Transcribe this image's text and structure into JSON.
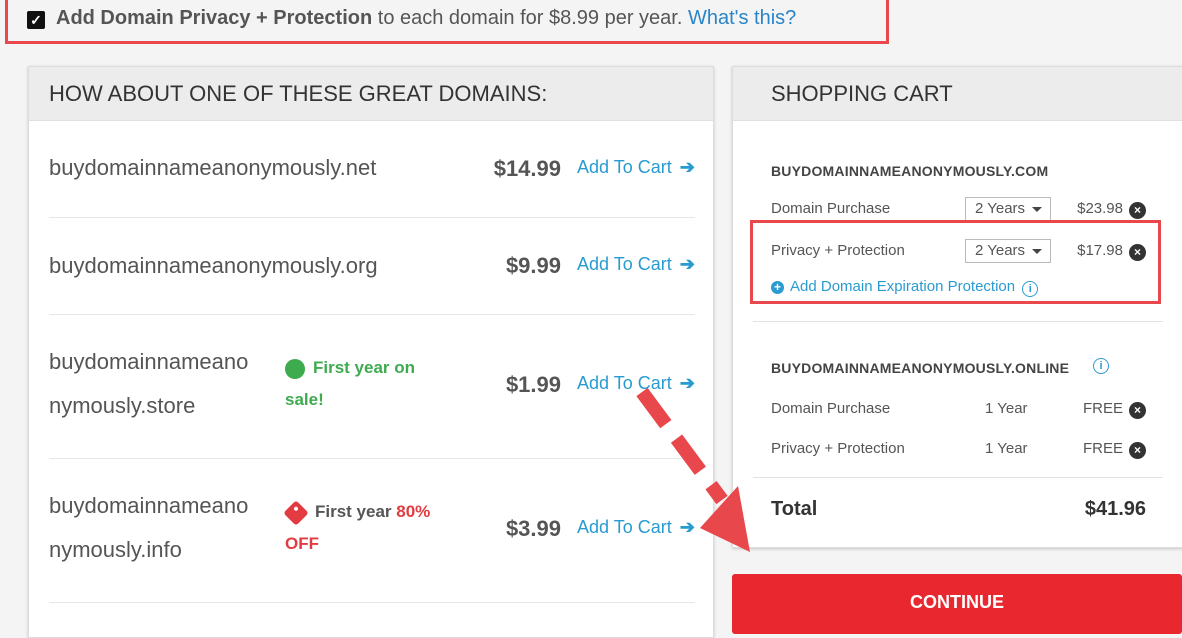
{
  "privacy_option": {
    "checked": true,
    "bold_text": "Add Domain Privacy + Protection",
    "rest_text": " to each domain for $8.99 per year. ",
    "link": "What's this?"
  },
  "suggestions": {
    "title": "HOW ABOUT ONE OF THESE GREAT DOMAINS:",
    "add_label": "Add To Cart",
    "items": [
      {
        "name": "buydomainnameanonymously.net",
        "price": "$14.99"
      },
      {
        "name": "buydomainnameanonymously.org",
        "price": "$9.99"
      },
      {
        "name_line1": "buydomainnameano",
        "name_line2": "nymously.store",
        "price": "$1.99",
        "promo_line1": "First year on",
        "promo_line2": "sale!",
        "promo_color": "#3eab4f"
      },
      {
        "name_line1": "buydomainnameano",
        "name_line2": "nymously.info",
        "price": "$3.99",
        "promo_prefix": "First year ",
        "promo_highlight": "80%",
        "promo_line2": "OFF",
        "promo_color": "#e23b41"
      }
    ]
  },
  "cart": {
    "title": "SHOPPING CART",
    "domains": [
      {
        "name": "BUYDOMAINNAMEANONYMOUSLY.COM",
        "lines": [
          {
            "label": "Domain Purchase",
            "term": "2 Years",
            "price": "$23.98"
          },
          {
            "label": "Privacy + Protection",
            "term": "2 Years",
            "price": "$17.98"
          }
        ],
        "addon_link": "Add Domain Expiration Protection"
      },
      {
        "name": "BUYDOMAINNAMEANONYMOUSLY.ONLINE",
        "lines": [
          {
            "label": "Domain Purchase",
            "term": "1 Year",
            "price": "FREE"
          },
          {
            "label": "Privacy + Protection",
            "term": "1 Year",
            "price": "FREE"
          }
        ]
      }
    ],
    "total_label": "Total",
    "total_value": "$41.96",
    "continue_label": "CONTINUE"
  },
  "colors": {
    "accent_red": "#e8272f",
    "link_blue": "#2a9bd0",
    "annotation_red": "#e8474c"
  }
}
